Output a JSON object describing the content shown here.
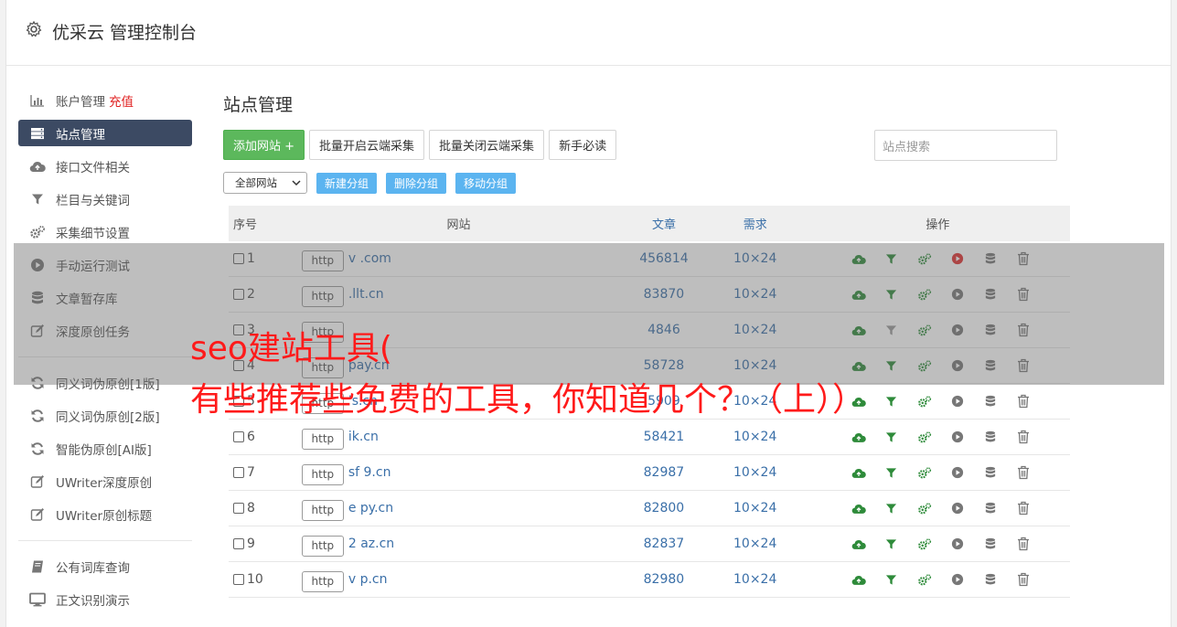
{
  "header": {
    "title": "优采云 管理控制台",
    "icon": "gear-icon"
  },
  "sidebar": {
    "items": [
      {
        "label": "账户管理",
        "extra": "充值",
        "icon": "bar-chart-icon"
      },
      {
        "label": "站点管理",
        "icon": "server-icon",
        "active": true
      },
      {
        "label": "接口文件相关",
        "icon": "cloud-upload-icon"
      },
      {
        "label": "栏目与关键词",
        "icon": "filter-icon"
      },
      {
        "label": "采集细节设置",
        "icon": "gears-icon"
      },
      {
        "label": "手动运行测试",
        "icon": "play-circle-icon"
      },
      {
        "label": "文章暂存库",
        "icon": "database-icon"
      },
      {
        "label": "深度原创任务",
        "icon": "edit-icon"
      }
    ],
    "items2": [
      {
        "label": "同义词伪原创[1版]",
        "icon": "refresh-icon"
      },
      {
        "label": "同义词伪原创[2版]",
        "icon": "refresh-icon"
      },
      {
        "label": "智能伪原创[AI版]",
        "icon": "refresh-icon"
      },
      {
        "label": "UWriter深度原创",
        "icon": "edit-icon"
      },
      {
        "label": "UWriter原创标题",
        "icon": "edit-icon"
      }
    ],
    "items3": [
      {
        "label": "公有词库查询",
        "icon": "book-icon"
      },
      {
        "label": "正文识别演示",
        "icon": "monitor-icon"
      }
    ]
  },
  "main": {
    "title": "站点管理",
    "buttons": {
      "add": "添加网站 +",
      "batch_open": "批量开启云端采集",
      "batch_close": "批量关闭云端采集",
      "guide": "新手必读"
    },
    "search_placeholder": "站点搜索",
    "group_select": "全部网站",
    "group_buttons": {
      "new": "新建分组",
      "delete": "删除分组",
      "move": "移动分组"
    },
    "table": {
      "headers": {
        "no": "序号",
        "site": "网站",
        "articles": "文章",
        "demand": "需求",
        "ops": "操作"
      },
      "rows": [
        {
          "no": "1",
          "http": "http",
          "url": "v            .com",
          "articles": "456814",
          "demand": "10×24",
          "play_active": true
        },
        {
          "no": "2",
          "http": "http",
          "url": "       .llt.cn",
          "articles": "83870",
          "demand": "10×24"
        },
        {
          "no": "3",
          "http": "http",
          "url": "",
          "articles": "4846",
          "demand": "10×24",
          "filter_dim": true
        },
        {
          "no": "4",
          "http": "http",
          "url": "         pay.cn",
          "articles": "58728",
          "demand": "10×24"
        },
        {
          "no": "5",
          "http": "http",
          "url": "        's.cn",
          "articles": "5909",
          "demand": "10×24"
        },
        {
          "no": "6",
          "http": "http",
          "url": "       ik.cn",
          "articles": "58421",
          "demand": "10×24"
        },
        {
          "no": "7",
          "http": "http",
          "url": "sf   9.cn",
          "articles": "82987",
          "demand": "10×24"
        },
        {
          "no": "8",
          "http": "http",
          "url": "e      py.cn",
          "articles": "82800",
          "demand": "10×24"
        },
        {
          "no": "9",
          "http": "http",
          "url": "2      az.cn",
          "articles": "82837",
          "demand": "10×24"
        },
        {
          "no": "10",
          "http": "http",
          "url": "v      p.cn",
          "articles": "82980",
          "demand": "10×24"
        }
      ]
    }
  },
  "overlay": {
    "line1": "seo建站工具(",
    "line2": "有些推荐些免费的工具，你知道几个？（上））"
  },
  "colors": {
    "accent_green": "#5cb85c",
    "nav_active": "#3c4a63",
    "link_blue": "#3a6fa8",
    "group_btn": "#5bb4f0",
    "overlay_text": "#ff1a1a"
  }
}
